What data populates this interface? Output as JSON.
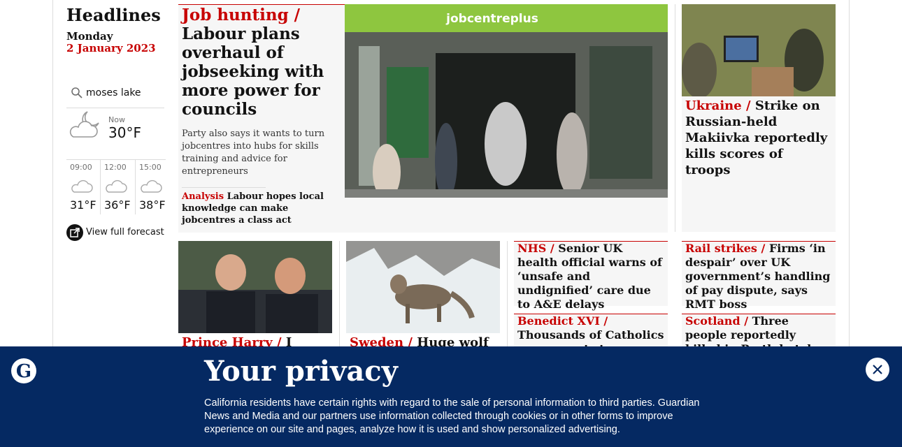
{
  "sidebar": {
    "heading": "Headlines",
    "day": "Monday",
    "date": "2 January 2023",
    "weather": {
      "location": "moses lake",
      "now_label": "Now",
      "now_temp": "30°F",
      "hours": [
        {
          "time": "09:00",
          "temp": "31°F"
        },
        {
          "time": "12:00",
          "temp": "36°F"
        },
        {
          "time": "15:00",
          "temp": "38°F"
        }
      ],
      "forecast_link": "View full forecast"
    }
  },
  "lead": {
    "kicker": "Job hunting /",
    "headline": "Labour plans overhaul of jobseeking with more power for councils",
    "standfirst": "Party also says it wants to turn jobcentres into hubs for skills training and advice for entrepreneurs",
    "related_kicker": "Analysis",
    "related_headline": "Labour hopes local knowledge can make jobcentres a class act",
    "image_sign": "jobcentreplus"
  },
  "ukraine": {
    "kicker": "Ukraine /",
    "headline": "Strike on Russian-held Makiivka reportedly kills scores of troops"
  },
  "row2": [
    {
      "kicker": "Prince Harry /",
      "headline": "I would"
    },
    {
      "kicker": "Sweden /",
      "headline": "Huge wolf"
    },
    {
      "kicker": "NHS /",
      "headline": "Senior UK health official warns of ‘unsafe and undignified’ care due to A&E delays"
    },
    {
      "kicker": "Rail strikes /",
      "headline": "Firms ‘in despair’ over UK government’s handling of pay dispute, says RMT boss"
    },
    {
      "kicker": "Benedict XVI /",
      "headline": "Thousands of Catholics pay respects to"
    },
    {
      "kicker": "Scotland /",
      "headline": "Three people reportedly killed in Perth hotel fire"
    }
  ],
  "privacy": {
    "title": "Your privacy",
    "body": "California residents have certain rights with regard to the sale of personal information to third parties. Guardian News and Media and our partners use information collected through cookies or in other forms to improve experience on our site and pages, analyze how it is used and show personalized advertising."
  },
  "colors": {
    "accent_red": "#c70000",
    "banner_blue": "#052962",
    "card_bg": "#f6f6f6"
  }
}
